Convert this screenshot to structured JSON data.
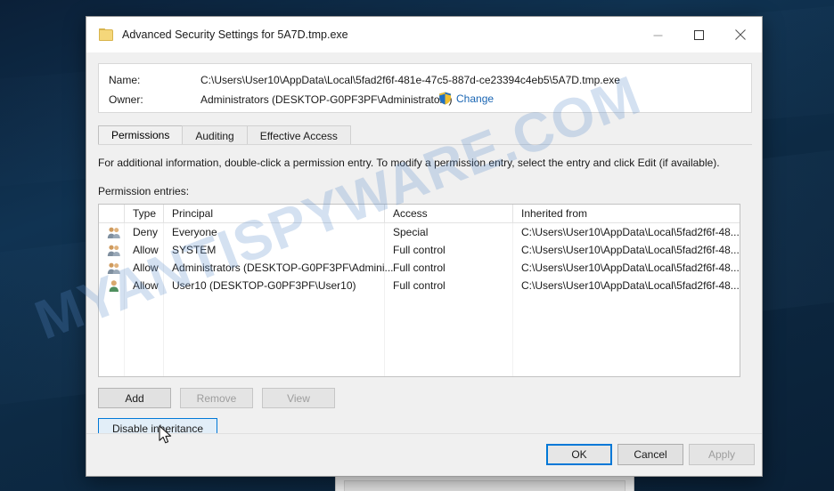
{
  "window": {
    "title": "Advanced Security Settings for 5A7D.tmp.exe",
    "icon": "folder-icon",
    "controls": {
      "minimize": "minimize-icon",
      "maximize": "maximize-icon",
      "close": "close-icon"
    }
  },
  "info": {
    "name_label": "Name:",
    "name_value": "C:\\Users\\User10\\AppData\\Local\\5fad2f6f-481e-47c5-887d-ce23394c4eb5\\5A7D.tmp.exe",
    "owner_label": "Owner:",
    "owner_value": "Administrators (DESKTOP-G0PF3PF\\Administrators)",
    "change_link": "Change",
    "change_icon": "uac-shield-icon"
  },
  "tabs": [
    {
      "label": "Permissions",
      "active": true
    },
    {
      "label": "Auditing",
      "active": false
    },
    {
      "label": "Effective Access",
      "active": false
    }
  ],
  "instructions": "For additional information, double-click a permission entry. To modify a permission entry, select the entry and click Edit (if available).",
  "entries_label": "Permission entries:",
  "table": {
    "columns": [
      "Type",
      "Principal",
      "Access",
      "Inherited from"
    ],
    "rows": [
      {
        "icon": "group-icon",
        "type": "Deny",
        "principal": "Everyone",
        "access": "Special",
        "inherited_from": "C:\\Users\\User10\\AppData\\Local\\5fad2f6f-48..."
      },
      {
        "icon": "group-icon",
        "type": "Allow",
        "principal": "SYSTEM",
        "access": "Full control",
        "inherited_from": "C:\\Users\\User10\\AppData\\Local\\5fad2f6f-48..."
      },
      {
        "icon": "group-icon",
        "type": "Allow",
        "principal": "Administrators (DESKTOP-G0PF3PF\\Admini...",
        "access": "Full control",
        "inherited_from": "C:\\Users\\User10\\AppData\\Local\\5fad2f6f-48..."
      },
      {
        "icon": "user-icon",
        "type": "Allow",
        "principal": "User10 (DESKTOP-G0PF3PF\\User10)",
        "access": "Full control",
        "inherited_from": "C:\\Users\\User10\\AppData\\Local\\5fad2f6f-48..."
      }
    ]
  },
  "buttons": {
    "add": "Add",
    "remove": "Remove",
    "view": "View",
    "disable_inheritance": "Disable inheritance",
    "ok": "OK",
    "cancel": "Cancel",
    "apply": "Apply"
  },
  "watermark": "MYANTISPYWARE.COM",
  "colors": {
    "accent": "#0078d7",
    "link": "#1965b3",
    "dialog_bg": "#f0f0f0",
    "desktop": "#103352"
  }
}
